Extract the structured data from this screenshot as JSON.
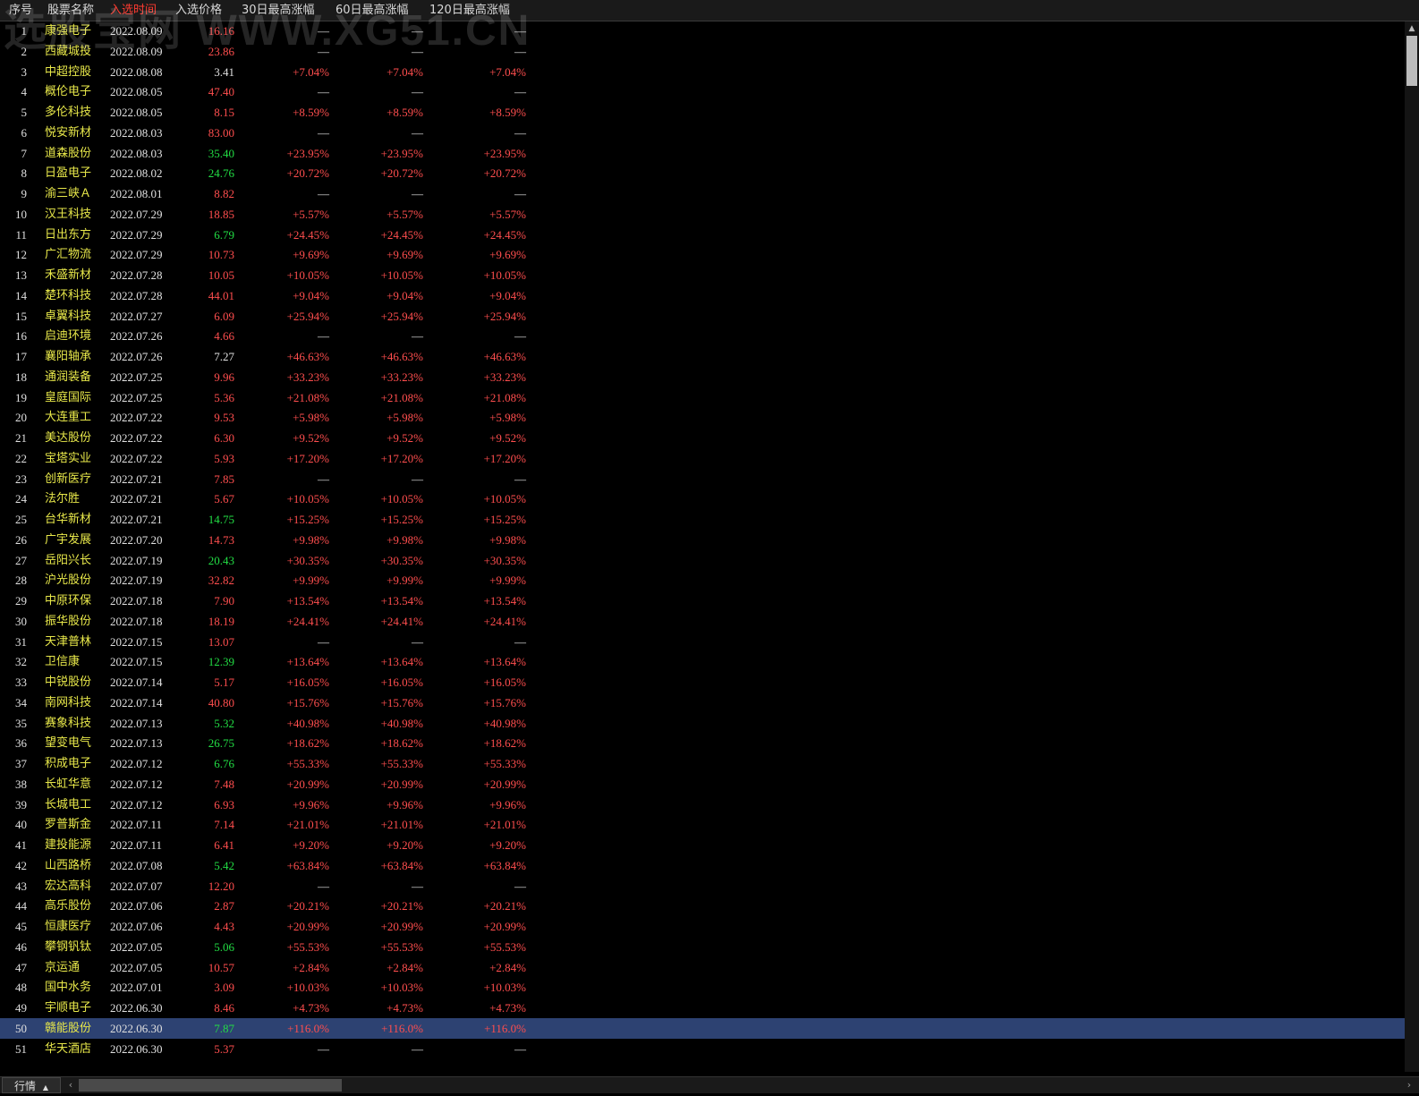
{
  "watermark": "选股宝网 WWW.XG51.CN",
  "header": {
    "columns": [
      "序号",
      "股票名称",
      "入选时间",
      "入选价格",
      "30日最高涨幅",
      "60日最高涨幅",
      "120日最高涨幅"
    ],
    "active_column": "入选时间"
  },
  "colors": {
    "up": "#ff4e4e",
    "down": "#22dd44",
    "flat": "#e0e0e0",
    "name": "#e8e84a",
    "selected_row": "#2d4272"
  },
  "selected_index": 50,
  "rows": [
    {
      "idx": "1",
      "name": "康强电子",
      "date": "2022.08.09",
      "price": "16.16",
      "price_color": "red",
      "g30": "—",
      "g60": "—",
      "g120": "—"
    },
    {
      "idx": "2",
      "name": "西藏城投",
      "date": "2022.08.09",
      "price": "23.86",
      "price_color": "red",
      "g30": "—",
      "g60": "—",
      "g120": "—"
    },
    {
      "idx": "3",
      "name": "中超控股",
      "date": "2022.08.08",
      "price": "3.41",
      "price_color": "white",
      "g30": "+7.04%",
      "g60": "+7.04%",
      "g120": "+7.04%"
    },
    {
      "idx": "4",
      "name": "概伦电子",
      "date": "2022.08.05",
      "price": "47.40",
      "price_color": "red",
      "g30": "—",
      "g60": "—",
      "g120": "—"
    },
    {
      "idx": "5",
      "name": "多伦科技",
      "date": "2022.08.05",
      "price": "8.15",
      "price_color": "red",
      "g30": "+8.59%",
      "g60": "+8.59%",
      "g120": "+8.59%"
    },
    {
      "idx": "6",
      "name": "悦安新材",
      "date": "2022.08.03",
      "price": "83.00",
      "price_color": "red",
      "g30": "—",
      "g60": "—",
      "g120": "—"
    },
    {
      "idx": "7",
      "name": "道森股份",
      "date": "2022.08.03",
      "price": "35.40",
      "price_color": "green",
      "g30": "+23.95%",
      "g60": "+23.95%",
      "g120": "+23.95%"
    },
    {
      "idx": "8",
      "name": "日盈电子",
      "date": "2022.08.02",
      "price": "24.76",
      "price_color": "green",
      "g30": "+20.72%",
      "g60": "+20.72%",
      "g120": "+20.72%"
    },
    {
      "idx": "9",
      "name": "渝三峡Ａ",
      "date": "2022.08.01",
      "price": "8.82",
      "price_color": "red",
      "g30": "—",
      "g60": "—",
      "g120": "—"
    },
    {
      "idx": "10",
      "name": "汉王科技",
      "date": "2022.07.29",
      "price": "18.85",
      "price_color": "red",
      "g30": "+5.57%",
      "g60": "+5.57%",
      "g120": "+5.57%"
    },
    {
      "idx": "11",
      "name": "日出东方",
      "date": "2022.07.29",
      "price": "6.79",
      "price_color": "green",
      "g30": "+24.45%",
      "g60": "+24.45%",
      "g120": "+24.45%"
    },
    {
      "idx": "12",
      "name": "广汇物流",
      "date": "2022.07.29",
      "price": "10.73",
      "price_color": "red",
      "g30": "+9.69%",
      "g60": "+9.69%",
      "g120": "+9.69%"
    },
    {
      "idx": "13",
      "name": "禾盛新材",
      "date": "2022.07.28",
      "price": "10.05",
      "price_color": "red",
      "g30": "+10.05%",
      "g60": "+10.05%",
      "g120": "+10.05%"
    },
    {
      "idx": "14",
      "name": "楚环科技",
      "date": "2022.07.28",
      "price": "44.01",
      "price_color": "red",
      "g30": "+9.04%",
      "g60": "+9.04%",
      "g120": "+9.04%"
    },
    {
      "idx": "15",
      "name": "卓翼科技",
      "date": "2022.07.27",
      "price": "6.09",
      "price_color": "red",
      "g30": "+25.94%",
      "g60": "+25.94%",
      "g120": "+25.94%"
    },
    {
      "idx": "16",
      "name": "启迪环境",
      "date": "2022.07.26",
      "price": "4.66",
      "price_color": "red",
      "g30": "—",
      "g60": "—",
      "g120": "—"
    },
    {
      "idx": "17",
      "name": "襄阳轴承",
      "date": "2022.07.26",
      "price": "7.27",
      "price_color": "white",
      "g30": "+46.63%",
      "g60": "+46.63%",
      "g120": "+46.63%"
    },
    {
      "idx": "18",
      "name": "通润装备",
      "date": "2022.07.25",
      "price": "9.96",
      "price_color": "red",
      "g30": "+33.23%",
      "g60": "+33.23%",
      "g120": "+33.23%"
    },
    {
      "idx": "19",
      "name": "皇庭国际",
      "date": "2022.07.25",
      "price": "5.36",
      "price_color": "red",
      "g30": "+21.08%",
      "g60": "+21.08%",
      "g120": "+21.08%"
    },
    {
      "idx": "20",
      "name": "大连重工",
      "date": "2022.07.22",
      "price": "9.53",
      "price_color": "red",
      "g30": "+5.98%",
      "g60": "+5.98%",
      "g120": "+5.98%"
    },
    {
      "idx": "21",
      "name": "美达股份",
      "date": "2022.07.22",
      "price": "6.30",
      "price_color": "red",
      "g30": "+9.52%",
      "g60": "+9.52%",
      "g120": "+9.52%"
    },
    {
      "idx": "22",
      "name": "宝塔实业",
      "date": "2022.07.22",
      "price": "5.93",
      "price_color": "red",
      "g30": "+17.20%",
      "g60": "+17.20%",
      "g120": "+17.20%"
    },
    {
      "idx": "23",
      "name": "创新医疗",
      "date": "2022.07.21",
      "price": "7.85",
      "price_color": "red",
      "g30": "—",
      "g60": "—",
      "g120": "—"
    },
    {
      "idx": "24",
      "name": "法尔胜",
      "date": "2022.07.21",
      "price": "5.67",
      "price_color": "red",
      "g30": "+10.05%",
      "g60": "+10.05%",
      "g120": "+10.05%"
    },
    {
      "idx": "25",
      "name": "台华新材",
      "date": "2022.07.21",
      "price": "14.75",
      "price_color": "green",
      "g30": "+15.25%",
      "g60": "+15.25%",
      "g120": "+15.25%"
    },
    {
      "idx": "26",
      "name": "广宇发展",
      "date": "2022.07.20",
      "price": "14.73",
      "price_color": "red",
      "g30": "+9.98%",
      "g60": "+9.98%",
      "g120": "+9.98%"
    },
    {
      "idx": "27",
      "name": "岳阳兴长",
      "date": "2022.07.19",
      "price": "20.43",
      "price_color": "green",
      "g30": "+30.35%",
      "g60": "+30.35%",
      "g120": "+30.35%"
    },
    {
      "idx": "28",
      "name": "沪光股份",
      "date": "2022.07.19",
      "price": "32.82",
      "price_color": "red",
      "g30": "+9.99%",
      "g60": "+9.99%",
      "g120": "+9.99%"
    },
    {
      "idx": "29",
      "name": "中原环保",
      "date": "2022.07.18",
      "price": "7.90",
      "price_color": "red",
      "g30": "+13.54%",
      "g60": "+13.54%",
      "g120": "+13.54%"
    },
    {
      "idx": "30",
      "name": "振华股份",
      "date": "2022.07.18",
      "price": "18.19",
      "price_color": "red",
      "g30": "+24.41%",
      "g60": "+24.41%",
      "g120": "+24.41%"
    },
    {
      "idx": "31",
      "name": "天津普林",
      "date": "2022.07.15",
      "price": "13.07",
      "price_color": "red",
      "g30": "—",
      "g60": "—",
      "g120": "—"
    },
    {
      "idx": "32",
      "name": "卫信康",
      "date": "2022.07.15",
      "price": "12.39",
      "price_color": "green",
      "g30": "+13.64%",
      "g60": "+13.64%",
      "g120": "+13.64%"
    },
    {
      "idx": "33",
      "name": "中锐股份",
      "date": "2022.07.14",
      "price": "5.17",
      "price_color": "red",
      "g30": "+16.05%",
      "g60": "+16.05%",
      "g120": "+16.05%"
    },
    {
      "idx": "34",
      "name": "南网科技",
      "date": "2022.07.14",
      "price": "40.80",
      "price_color": "red",
      "g30": "+15.76%",
      "g60": "+15.76%",
      "g120": "+15.76%"
    },
    {
      "idx": "35",
      "name": "赛象科技",
      "date": "2022.07.13",
      "price": "5.32",
      "price_color": "green",
      "g30": "+40.98%",
      "g60": "+40.98%",
      "g120": "+40.98%"
    },
    {
      "idx": "36",
      "name": "望变电气",
      "date": "2022.07.13",
      "price": "26.75",
      "price_color": "green",
      "g30": "+18.62%",
      "g60": "+18.62%",
      "g120": "+18.62%"
    },
    {
      "idx": "37",
      "name": "积成电子",
      "date": "2022.07.12",
      "price": "6.76",
      "price_color": "green",
      "g30": "+55.33%",
      "g60": "+55.33%",
      "g120": "+55.33%"
    },
    {
      "idx": "38",
      "name": "长虹华意",
      "date": "2022.07.12",
      "price": "7.48",
      "price_color": "red",
      "g30": "+20.99%",
      "g60": "+20.99%",
      "g120": "+20.99%"
    },
    {
      "idx": "39",
      "name": "长城电工",
      "date": "2022.07.12",
      "price": "6.93",
      "price_color": "red",
      "g30": "+9.96%",
      "g60": "+9.96%",
      "g120": "+9.96%"
    },
    {
      "idx": "40",
      "name": "罗普斯金",
      "date": "2022.07.11",
      "price": "7.14",
      "price_color": "red",
      "g30": "+21.01%",
      "g60": "+21.01%",
      "g120": "+21.01%"
    },
    {
      "idx": "41",
      "name": "建投能源",
      "date": "2022.07.11",
      "price": "6.41",
      "price_color": "red",
      "g30": "+9.20%",
      "g60": "+9.20%",
      "g120": "+9.20%"
    },
    {
      "idx": "42",
      "name": "山西路桥",
      "date": "2022.07.08",
      "price": "5.42",
      "price_color": "green",
      "g30": "+63.84%",
      "g60": "+63.84%",
      "g120": "+63.84%"
    },
    {
      "idx": "43",
      "name": "宏达高科",
      "date": "2022.07.07",
      "price": "12.20",
      "price_color": "red",
      "g30": "—",
      "g60": "—",
      "g120": "—"
    },
    {
      "idx": "44",
      "name": "高乐股份",
      "date": "2022.07.06",
      "price": "2.87",
      "price_color": "red",
      "g30": "+20.21%",
      "g60": "+20.21%",
      "g120": "+20.21%"
    },
    {
      "idx": "45",
      "name": "恒康医疗",
      "date": "2022.07.06",
      "price": "4.43",
      "price_color": "red",
      "g30": "+20.99%",
      "g60": "+20.99%",
      "g120": "+20.99%"
    },
    {
      "idx": "46",
      "name": "攀钢钒钛",
      "date": "2022.07.05",
      "price": "5.06",
      "price_color": "green",
      "g30": "+55.53%",
      "g60": "+55.53%",
      "g120": "+55.53%"
    },
    {
      "idx": "47",
      "name": "京运通",
      "date": "2022.07.05",
      "price": "10.57",
      "price_color": "red",
      "g30": "+2.84%",
      "g60": "+2.84%",
      "g120": "+2.84%"
    },
    {
      "idx": "48",
      "name": "国中水务",
      "date": "2022.07.01",
      "price": "3.09",
      "price_color": "red",
      "g30": "+10.03%",
      "g60": "+10.03%",
      "g120": "+10.03%"
    },
    {
      "idx": "49",
      "name": "宇顺电子",
      "date": "2022.06.30",
      "price": "8.46",
      "price_color": "red",
      "g30": "+4.73%",
      "g60": "+4.73%",
      "g120": "+4.73%"
    },
    {
      "idx": "50",
      "name": "赣能股份",
      "date": "2022.06.30",
      "price": "7.87",
      "price_color": "green",
      "g30": "+116.0%",
      "g60": "+116.0%",
      "g120": "+116.0%"
    },
    {
      "idx": "51",
      "name": "华天酒店",
      "date": "2022.06.30",
      "price": "5.37",
      "price_color": "red",
      "g30": "—",
      "g60": "—",
      "g120": "—"
    }
  ],
  "bottom": {
    "tab_label": "行情",
    "tab_arrow": "▲",
    "scroll_left": "‹",
    "scroll_right": "›",
    "scroll_up": "▲"
  }
}
